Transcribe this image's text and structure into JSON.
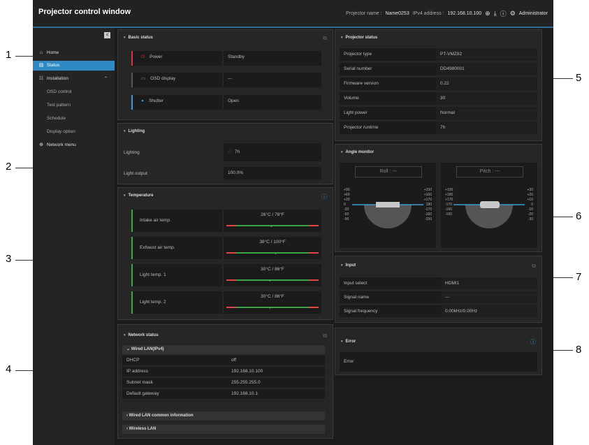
{
  "window": {
    "title": "Projector control window"
  },
  "topbar": {
    "projector_name_label": "Projector name :",
    "projector_name": "Name0253",
    "ipv4_label": "IPv4 address :",
    "ipv4": "192.168.10.100",
    "user": "Administrator",
    "icons": [
      "network-icon",
      "download-icon",
      "info-icon",
      "gear-icon"
    ]
  },
  "sidebar": {
    "collapse": "<",
    "items": [
      {
        "label": "Home",
        "icon": "home-icon"
      },
      {
        "label": "Status",
        "icon": "status-icon",
        "active": true
      },
      {
        "label": "Installation",
        "icon": "installation-icon",
        "expanded": true
      },
      {
        "label": "OSD control",
        "sub": true
      },
      {
        "label": "Test pattern",
        "sub": true
      },
      {
        "label": "Schedule",
        "sub": true
      },
      {
        "label": "Display option",
        "sub": true
      },
      {
        "label": "Network menu",
        "icon": "globe-icon"
      }
    ]
  },
  "basic": {
    "title": "Basic status",
    "rows": [
      {
        "label": "Power",
        "value": "Standby",
        "color": "#d9363e"
      },
      {
        "label": "OSD display",
        "value": "---",
        "color": "#555555"
      },
      {
        "label": "Shutter",
        "value": "Open",
        "color": "#3f9ad6"
      }
    ]
  },
  "lighting": {
    "title": "Lighting",
    "rows": [
      {
        "label": "Lighting",
        "value": "7h"
      },
      {
        "label": "Light output",
        "value": "100.0%"
      }
    ]
  },
  "temperature": {
    "title": "Temperature",
    "rows": [
      {
        "label": "Intake air temp.",
        "value": "26°C / 78°F"
      },
      {
        "label": "Exhaust air temp.",
        "value": "38°C / 100°F"
      },
      {
        "label": "Light temp. 1",
        "value": "30°C / 86°F"
      },
      {
        "label": "Light temp. 2",
        "value": "30°C / 86°F"
      }
    ]
  },
  "network": {
    "title": "Network status",
    "wired_header": "Wired LAN(IPv4)",
    "rows": [
      {
        "label": "DHCP",
        "value": "off"
      },
      {
        "label": "IP address",
        "value": "192.168.10.100"
      },
      {
        "label": "Subnet mask",
        "value": "255.255.255.0"
      },
      {
        "label": "Default gateway",
        "value": "192.168.10.1"
      }
    ],
    "common_header": "Wired LAN common information",
    "wireless_header": "Wireless LAN"
  },
  "projector": {
    "title": "Projector status",
    "rows": [
      {
        "label": "Projector type",
        "value": "PT-VMZ82"
      },
      {
        "label": "Serial number",
        "value": "DD4980001"
      },
      {
        "label": "Firmware version",
        "value": "0.22"
      },
      {
        "label": "Volume",
        "value": "30"
      },
      {
        "label": "Light power",
        "value": "Normal"
      },
      {
        "label": "Projector runtime",
        "value": "7h"
      }
    ]
  },
  "angle": {
    "title": "Angle monitor",
    "roll": "Roll : ---",
    "pitch": "Pitch : ---",
    "roll_left": [
      "+90",
      "+60",
      "+30",
      "0",
      "-30",
      "-60",
      "-90"
    ],
    "roll_right": [
      "+150",
      "+160",
      "+170",
      "180",
      "-170",
      "-160",
      "-150"
    ],
    "pitch_left": [
      "+150",
      "+180",
      "+170",
      "-170",
      "-160",
      "-150"
    ],
    "pitch_right": [
      "+30",
      "+20",
      "+10",
      "0",
      "-10",
      "-20",
      "-30"
    ]
  },
  "input": {
    "title": "Input",
    "rows": [
      {
        "label": "Input select",
        "value": "HDMI1"
      },
      {
        "label": "Signal name",
        "value": "---"
      },
      {
        "label": "Signal frequency",
        "value": "0.00kHz/0.00Hz"
      }
    ]
  },
  "error": {
    "title": "Error",
    "label": "Error",
    "value": ""
  },
  "callouts": [
    "1",
    "2",
    "3",
    "4",
    "5",
    "6",
    "7",
    "8"
  ]
}
